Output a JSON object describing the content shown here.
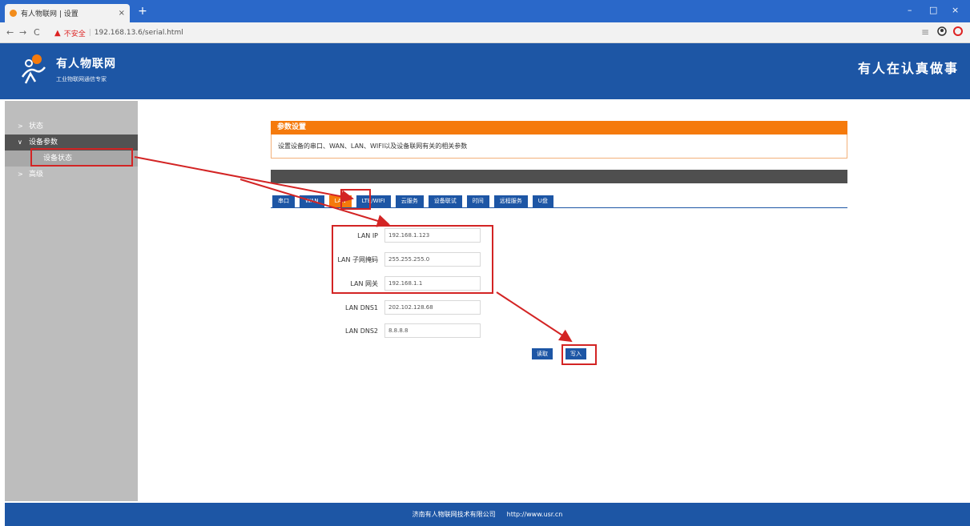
{
  "browser": {
    "tab_title": "有人物联网 | 设置",
    "tab_close": "×",
    "new_tab": "+",
    "back": "←",
    "forward": "→",
    "reload": "C",
    "insecure_label": "不安全",
    "url": "192.168.13.6/serial.html",
    "win_min": "–",
    "win_max": "□",
    "win_close": "×",
    "menu_icon": "≡"
  },
  "header": {
    "brand": "有人物联网",
    "brand_sub": "工业物联网通信专家",
    "slogan": "有人在认真做事"
  },
  "sidebar": {
    "items": [
      {
        "label": "状态",
        "chevron": ">"
      },
      {
        "label": "设备参数",
        "chevron": "∨"
      },
      {
        "label": "设备状态"
      },
      {
        "label": "高级",
        "chevron": ">"
      }
    ]
  },
  "panel": {
    "title": "参数设置",
    "description": "设置设备的串口、WAN、LAN、WIFI以及设备联网有关的相关参数"
  },
  "tabs": [
    "串口",
    "WAN",
    "LAN",
    "LTE/WIFI",
    "云服务",
    "设备联试",
    "时间",
    "远程服务",
    "U盘"
  ],
  "form": {
    "fields": [
      {
        "label": "LAN IP",
        "value": "192.168.1.123"
      },
      {
        "label": "LAN 子网掩码",
        "value": "255.255.255.0"
      },
      {
        "label": "LAN 网关",
        "value": "192.168.1.1"
      },
      {
        "label": "LAN DNS1",
        "value": "202.102.128.68"
      },
      {
        "label": "LAN DNS2",
        "value": "8.8.8.8"
      }
    ],
    "cancel_label": "读取",
    "save_label": "写入"
  },
  "footer": {
    "company": "济南有人物联网技术有限公司",
    "url": "http://www.usr.cn"
  },
  "colors": {
    "primary": "#1d56a5",
    "accent": "#f57a0c",
    "annotation": "#d32424"
  }
}
